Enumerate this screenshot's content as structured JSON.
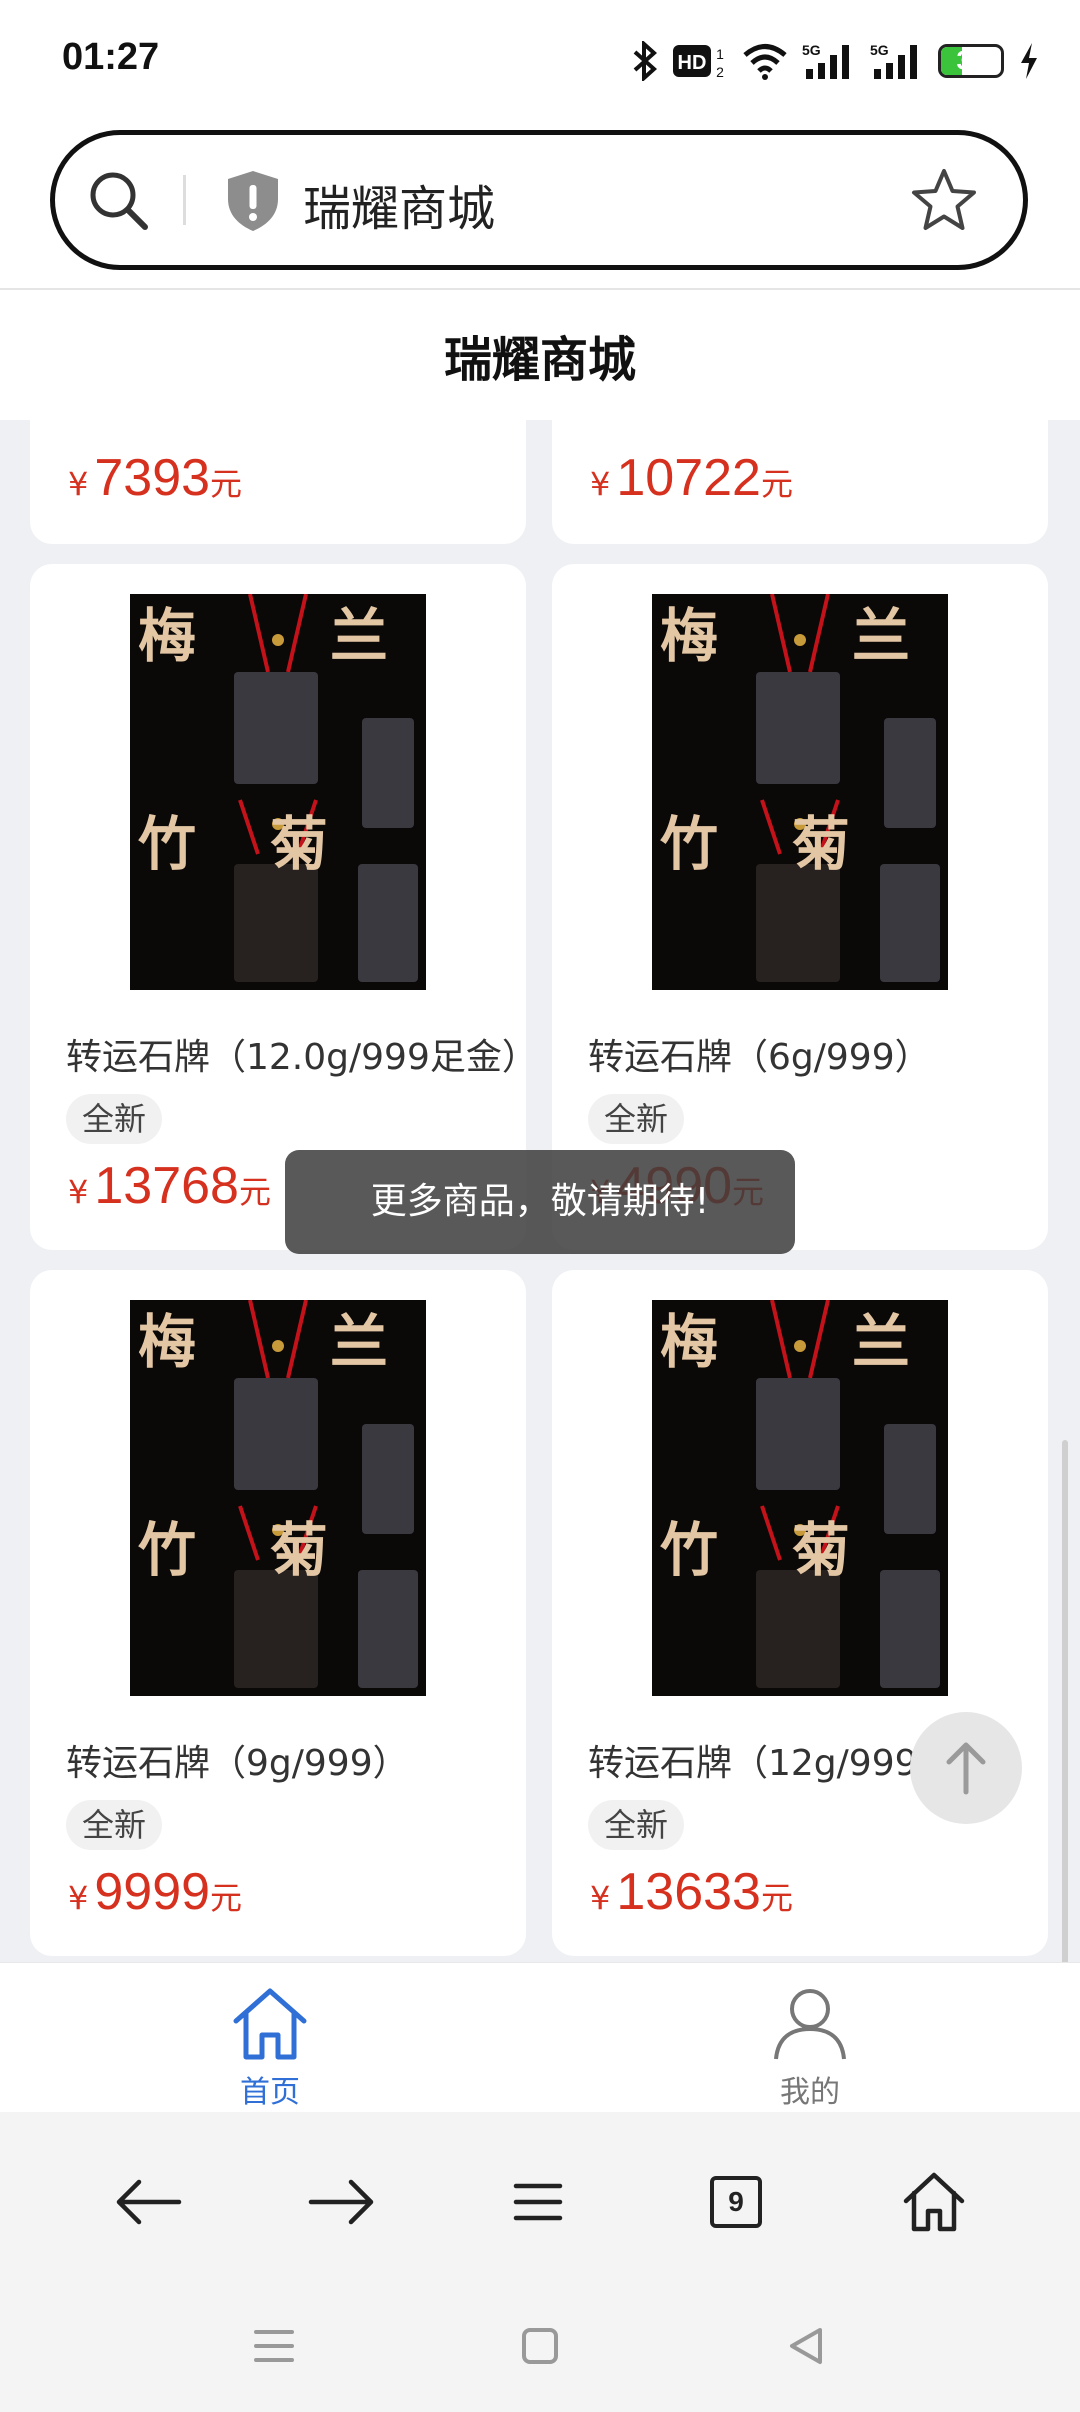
{
  "status": {
    "time": "01:27",
    "battery": "35",
    "battery_level": 0.35,
    "net1": "5G",
    "net2": "5G",
    "hd": "HD"
  },
  "urlbar": {
    "text": "瑞耀商城"
  },
  "site": {
    "title": "瑞耀商城"
  },
  "products": [
    {
      "name": "",
      "badge": "",
      "currency": "¥",
      "price": "7393",
      "unit": "元"
    },
    {
      "name": "",
      "badge": "",
      "currency": "¥",
      "price": "10722",
      "unit": "元"
    },
    {
      "name": "转运石牌（12.0g/999足金）",
      "badge": "全新",
      "currency": "¥",
      "price": "13768",
      "unit": "元"
    },
    {
      "name": "转运石牌（6g/999）",
      "badge": "全新",
      "currency": "¥",
      "price": "4990",
      "unit": "元"
    },
    {
      "name": "转运石牌（9g/999）",
      "badge": "全新",
      "currency": "¥",
      "price": "9999",
      "unit": "元"
    },
    {
      "name": "转运石牌（12g/999）",
      "badge": "全新",
      "currency": "¥",
      "price": "13633",
      "unit": "元"
    }
  ],
  "image_text": {
    "c1": "梅",
    "c2": "兰",
    "c3": "竹",
    "c4": "菊"
  },
  "toast": {
    "text": "更多商品，敬请期待!"
  },
  "tabbar": {
    "home": "首页",
    "mine": "我的"
  },
  "browser": {
    "tabs_count": "9"
  },
  "colors": {
    "price": "#d6301f",
    "active_tab": "#2f6fd6",
    "inactive_tab": "#777777"
  }
}
